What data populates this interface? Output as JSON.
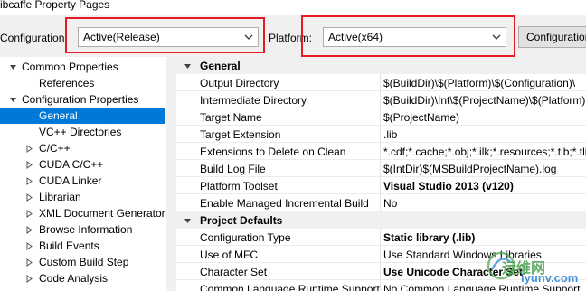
{
  "window": {
    "title": "ibcaffe Property Pages"
  },
  "toolbar": {
    "configuration_label": "Configuration:",
    "configuration_value": "Active(Release)",
    "platform_label": "Platform:",
    "platform_value": "Active(x64)",
    "config_manager_button": "Configuration Manager..."
  },
  "highlight_color": "#e31b23",
  "tree": {
    "items": [
      {
        "label": "Common Properties",
        "expanded": true,
        "icon": "triangle-down-icon"
      },
      {
        "label": "References"
      },
      {
        "label": "Configuration Properties",
        "expanded": true,
        "icon": "triangle-down-icon"
      },
      {
        "label": "General",
        "selected": true
      },
      {
        "label": "VC++ Directories"
      },
      {
        "label": "C/C++",
        "icon": "triangle-right-icon"
      },
      {
        "label": "CUDA C/C++",
        "icon": "triangle-right-icon"
      },
      {
        "label": "CUDA Linker",
        "icon": "triangle-right-icon"
      },
      {
        "label": "Librarian",
        "icon": "triangle-right-icon"
      },
      {
        "label": "XML Document Generator",
        "icon": "triangle-right-icon"
      },
      {
        "label": "Browse Information",
        "icon": "triangle-right-icon"
      },
      {
        "label": "Build Events",
        "icon": "triangle-right-icon"
      },
      {
        "label": "Custom Build Step",
        "icon": "triangle-right-icon"
      },
      {
        "label": "Code Analysis",
        "icon": "triangle-right-icon"
      }
    ],
    "selected_color": "#0078d7"
  },
  "grid": {
    "general": {
      "title": "General",
      "rows": [
        {
          "key": "Output Directory",
          "value": "$(BuildDir)\\$(Platform)\\$(Configuration)\\"
        },
        {
          "key": "Intermediate Directory",
          "value": "$(BuildDir)\\Int\\$(ProjectName)\\$(Platform)"
        },
        {
          "key": "Target Name",
          "value": "$(ProjectName)"
        },
        {
          "key": "Target Extension",
          "value": ".lib"
        },
        {
          "key": "Extensions to Delete on Clean",
          "value": "*.cdf;*.cache;*.obj;*.ilk;*.resources;*.tlb;*.tli"
        },
        {
          "key": "Build Log File",
          "value": "$(IntDir)$(MSBuildProjectName).log"
        },
        {
          "key": "Platform Toolset",
          "value": "Visual Studio 2013 (v120)",
          "bold": true
        },
        {
          "key": "Enable Managed Incremental Build",
          "value": "No"
        }
      ]
    },
    "project_defaults": {
      "title": "Project Defaults",
      "rows": [
        {
          "key": "Configuration Type",
          "value": "Static library (.lib)",
          "bold": true
        },
        {
          "key": "Use of MFC",
          "value": "Use Standard Windows Libraries"
        },
        {
          "key": "Character Set",
          "value": "Use Unicode Character Set",
          "bold": true
        },
        {
          "key": "Common Language Runtime Support",
          "value": "No Common Language Runtime Support"
        }
      ]
    }
  },
  "watermark": {
    "text1": "运维网",
    "text2": "iyunv.com"
  }
}
